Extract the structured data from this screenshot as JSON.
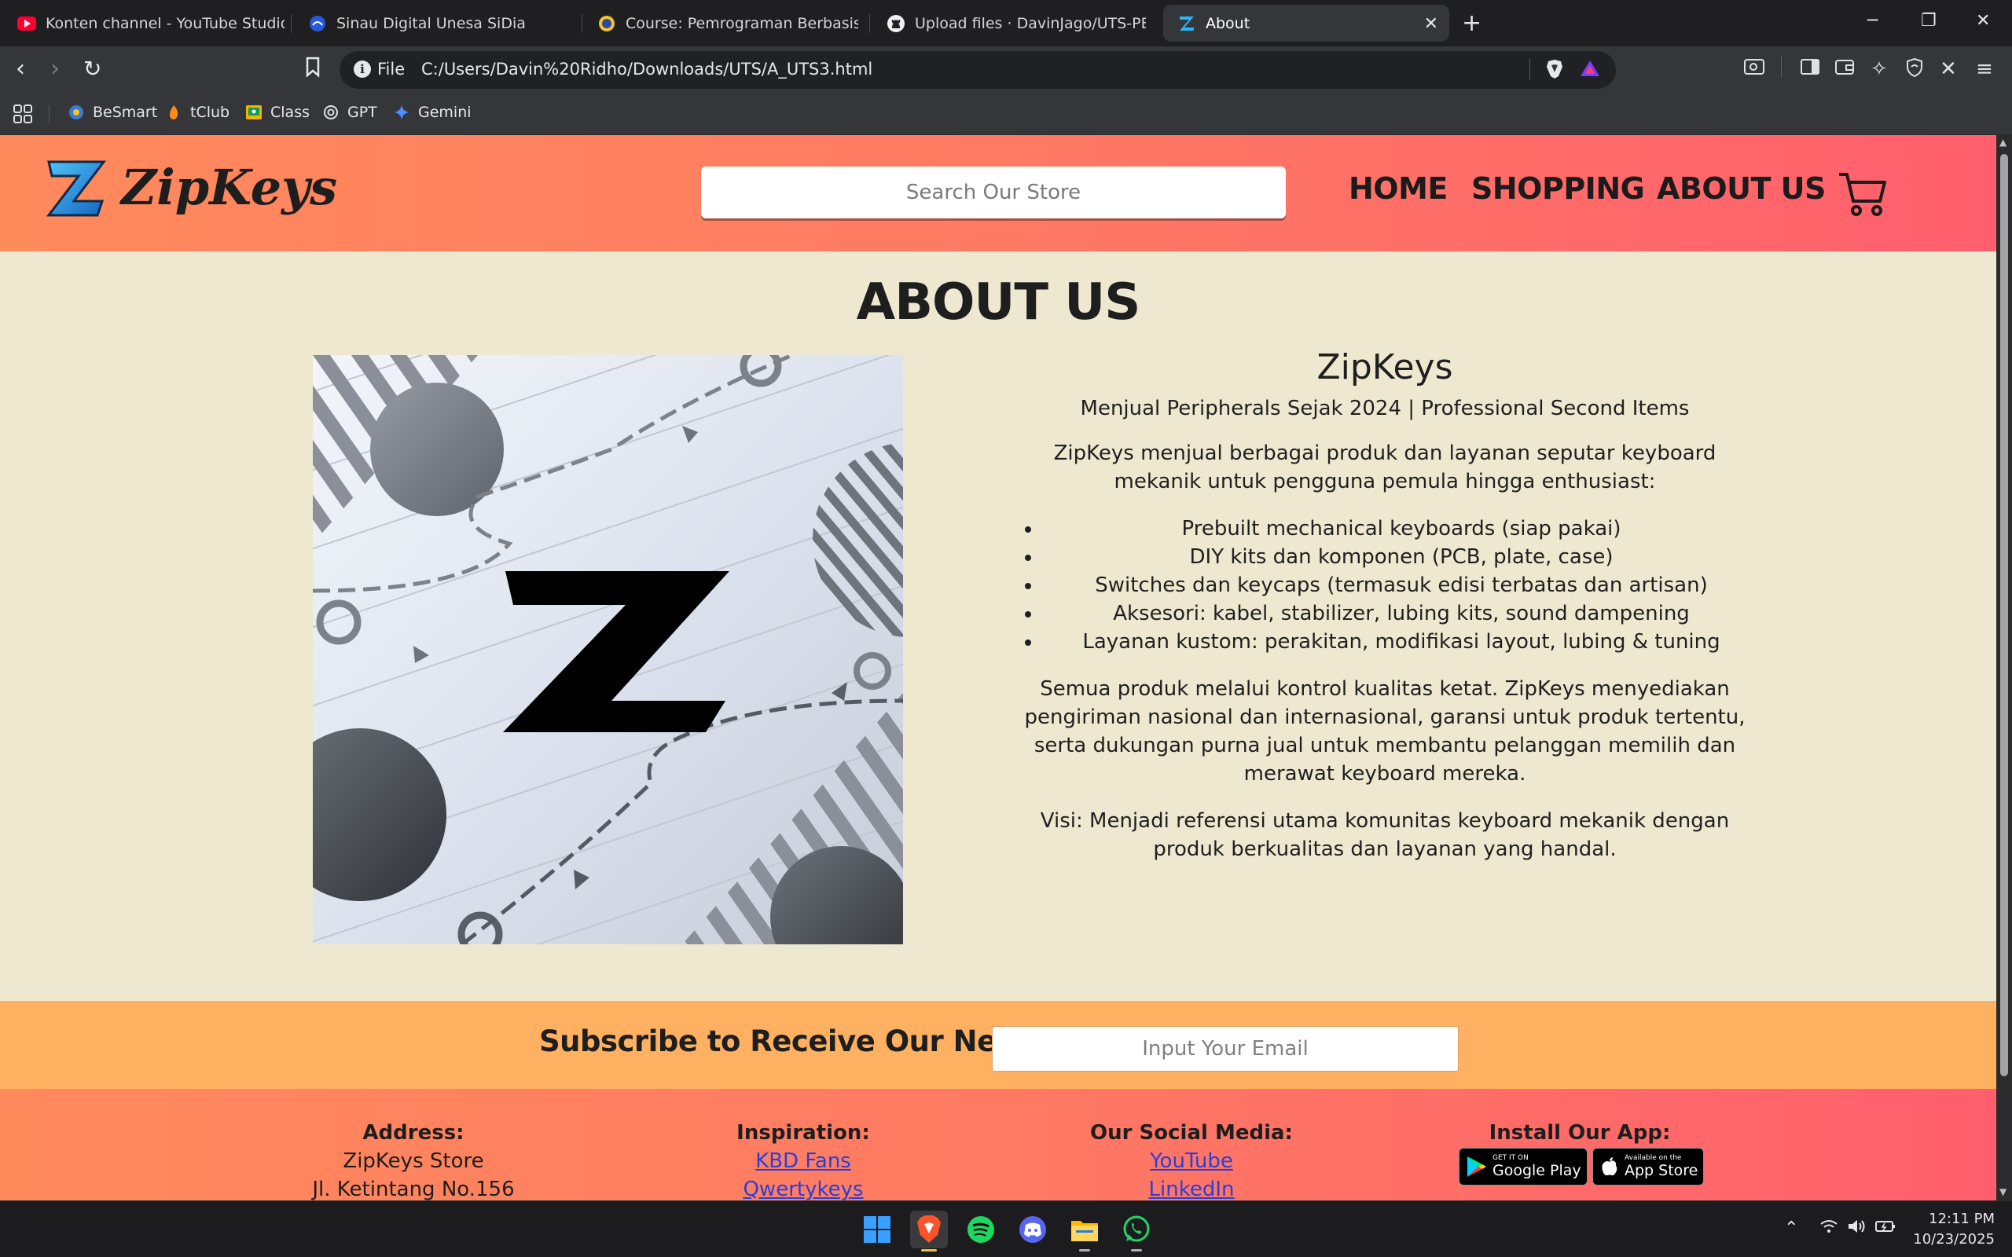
{
  "browser": {
    "tabs": [
      {
        "title": "Konten channel - YouTube Studio",
        "icon": "youtube-icon",
        "active": false
      },
      {
        "title": "Sinau Digital Unesa SiDia",
        "icon": "sidia-icon",
        "active": false
      },
      {
        "title": "Course: Pemrograman Berbasis Platfo",
        "icon": "course-icon",
        "active": false
      },
      {
        "title": "Upload files · DavinJago/UTS-PBP",
        "icon": "github-icon",
        "active": false
      },
      {
        "title": "About",
        "icon": "zipkeys-icon",
        "active": true
      }
    ],
    "omnibox": {
      "scheme_label": "File",
      "url": "C:/Users/Davin%20Ridho/Downloads/UTS/A_UTS3.html"
    },
    "bookmarks": [
      {
        "label": "BeSmart",
        "icon": "besmart-icon"
      },
      {
        "label": "tClub",
        "icon": "tclub-icon"
      },
      {
        "label": "Class",
        "icon": "classroom-icon"
      },
      {
        "label": "GPT",
        "icon": "openai-icon"
      },
      {
        "label": "Gemini",
        "icon": "gemini-icon"
      }
    ]
  },
  "site": {
    "brand": "ZipKeys",
    "search_placeholder": "Search Our Store",
    "nav": {
      "home": "HOME",
      "shopping": "SHOPPING",
      "about": "ABOUT US"
    },
    "page_title": "ABOUT US",
    "about": {
      "name": "ZipKeys",
      "tagline": "Menjual Peripherals Sejak 2024 | Professional Second Items",
      "intro": "ZipKeys menjual berbagai produk dan layanan seputar keyboard mekanik untuk pengguna pemula hingga enthusiast:",
      "items": [
        "Prebuilt mechanical keyboards (siap pakai)",
        "DIY kits dan komponen (PCB, plate, case)",
        "Switches dan keycaps (termasuk edisi terbatas dan artisan)",
        "Aksesori: kabel, stabilizer, lubing kits, sound dampening",
        "Layanan kustom: perakitan, modifikasi layout, lubing & tuning"
      ],
      "quality": "Semua produk melalui kontrol kualitas ketat. ZipKeys menyediakan pengiriman nasional dan internasional, garansi untuk produk tertentu, serta dukungan purna jual untuk membantu pelanggan memilih dan merawat keyboard mereka.",
      "vision": "Visi: Menjadi referensi utama komunitas keyboard mekanik dengan produk berkualitas dan layanan yang handal."
    },
    "subscribe": {
      "label": "Subscribe to Receive Our News :",
      "placeholder": "Input Your Email"
    },
    "footer": {
      "address": {
        "heading": "Address:",
        "line1": "ZipKeys Store",
        "line2": "Jl. Ketintang No.156"
      },
      "inspiration": {
        "heading": "Inspiration:",
        "links": [
          "KBD Fans",
          "Qwertykeys"
        ]
      },
      "social": {
        "heading": "Our Social Media:",
        "links": [
          "YouTube",
          "LinkedIn"
        ]
      },
      "app": {
        "heading": "Install Our App:",
        "google_small": "GET IT ON",
        "google_big": "Google Play",
        "apple_small": "Available on the",
        "apple_big": "App Store"
      }
    }
  },
  "taskbar": {
    "time": "12:11 PM",
    "date": "10/23/2025",
    "apps": [
      "windows-start-icon",
      "brave-icon",
      "spotify-icon",
      "discord-icon",
      "file-explorer-icon",
      "whatsapp-icon"
    ]
  },
  "colors": {
    "header_gradient_start": "#ff8a5c",
    "header_gradient_end": "#ff5f6d",
    "page_background": "#ede8cf",
    "subscribe_background": "#ffb061",
    "link": "#2a3fd8"
  }
}
